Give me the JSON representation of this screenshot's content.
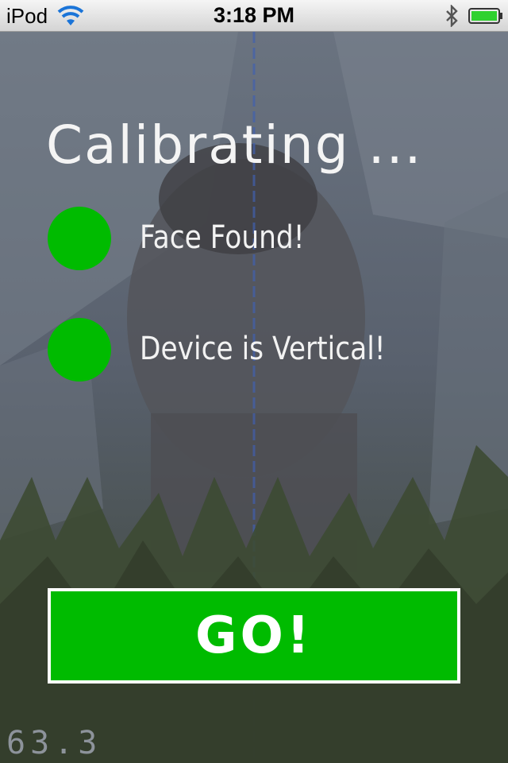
{
  "status_bar": {
    "device": "iPod",
    "time": "3:18 PM",
    "battery_color": "#2fd12f"
  },
  "title": "Calibrating ...",
  "checks": [
    {
      "label": "Face Found!",
      "status": "ok",
      "color": "#00bb00"
    },
    {
      "label": "Device is Vertical!",
      "status": "ok",
      "color": "#00bb00"
    }
  ],
  "go_button": {
    "label": "GO!",
    "color": "#00bb00"
  },
  "fps_readout": "63.3",
  "colors": {
    "accent_green": "#00bb00",
    "text": "#f4f4f4"
  }
}
